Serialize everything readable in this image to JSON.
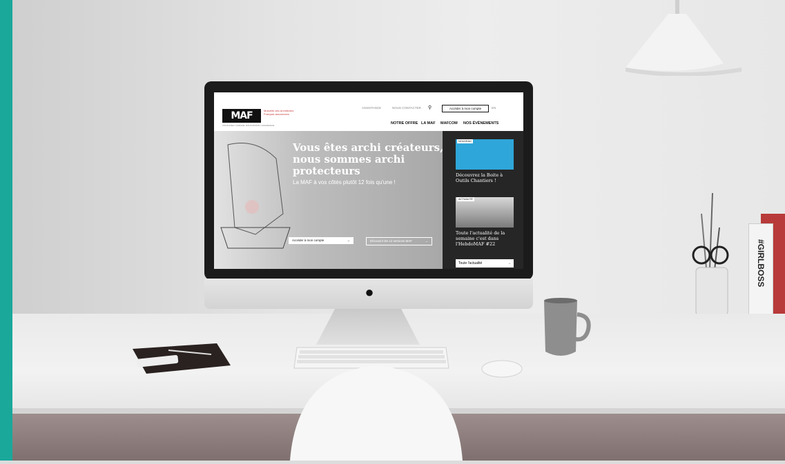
{
  "site": {
    "logo_text": "MAF",
    "logo_subtitle": "Mutuelle des Architectes Français assurances",
    "tagline": "VOUS AVEZ L'AUDACE, NOUS AVONS L'ASSURANCE",
    "top_links": [
      "ASSISTANCE",
      "NOUS CONTACTER"
    ],
    "account_button": "Accéder à mon compte",
    "lang_button": "EN",
    "nav": [
      "NOTRE OFFRE",
      "LA MAF",
      "MAFCOM",
      "NOS ÉVÉNEMENTS"
    ]
  },
  "hero": {
    "title": "Vous êtes archi créateurs, nous sommes archi protecteurs",
    "subtitle": "La MAF à vos côtés plutôt 12 fois qu'une !",
    "btn_account": "Accéder à mon compte",
    "btn_services": "Découvrir les 12 services MAF"
  },
  "sidebar": {
    "cards": [
      {
        "badge": "NOUVEAU",
        "text": "Découvrez la Boite à Outils Chantiers !"
      },
      {
        "badge": "ACTUALITÉ",
        "text": "Toute l'actualité de la semaine c'est dans l'HebdoMAF #22"
      }
    ],
    "all_news": "Toute l'actualité"
  },
  "book_spine": "#GIRLBOSS",
  "colors": {
    "accent_teal": "#1aa89b",
    "screen_dark": "#262626",
    "brand_red": "#c44444"
  },
  "icons": [
    "search-icon",
    "arrow-right-icon",
    "apple-icon"
  ]
}
